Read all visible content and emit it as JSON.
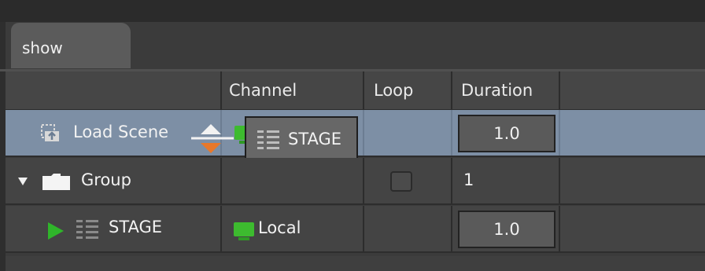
{
  "tab": {
    "label": "show"
  },
  "columns": {
    "channel": "Channel",
    "loop": "Loop",
    "duration": "Duration"
  },
  "rows": [
    {
      "name": "Load Scene",
      "channel": "",
      "duration": "1.0",
      "icon": "load-scene-icon",
      "selected": true
    },
    {
      "name": "Group",
      "loop": "",
      "duration": "1",
      "icon": "folder-icon",
      "expanded": true
    },
    {
      "name": "STAGE",
      "channel": "Local",
      "duration": "1.0",
      "icon": "scene-list-icon"
    }
  ],
  "drag": {
    "label": "STAGE",
    "icon": "scene-list-icon"
  },
  "colors": {
    "selected_row": "#7d8fa5",
    "accent_green": "#3dbb2f",
    "drop_arrow": "#e8782a"
  }
}
